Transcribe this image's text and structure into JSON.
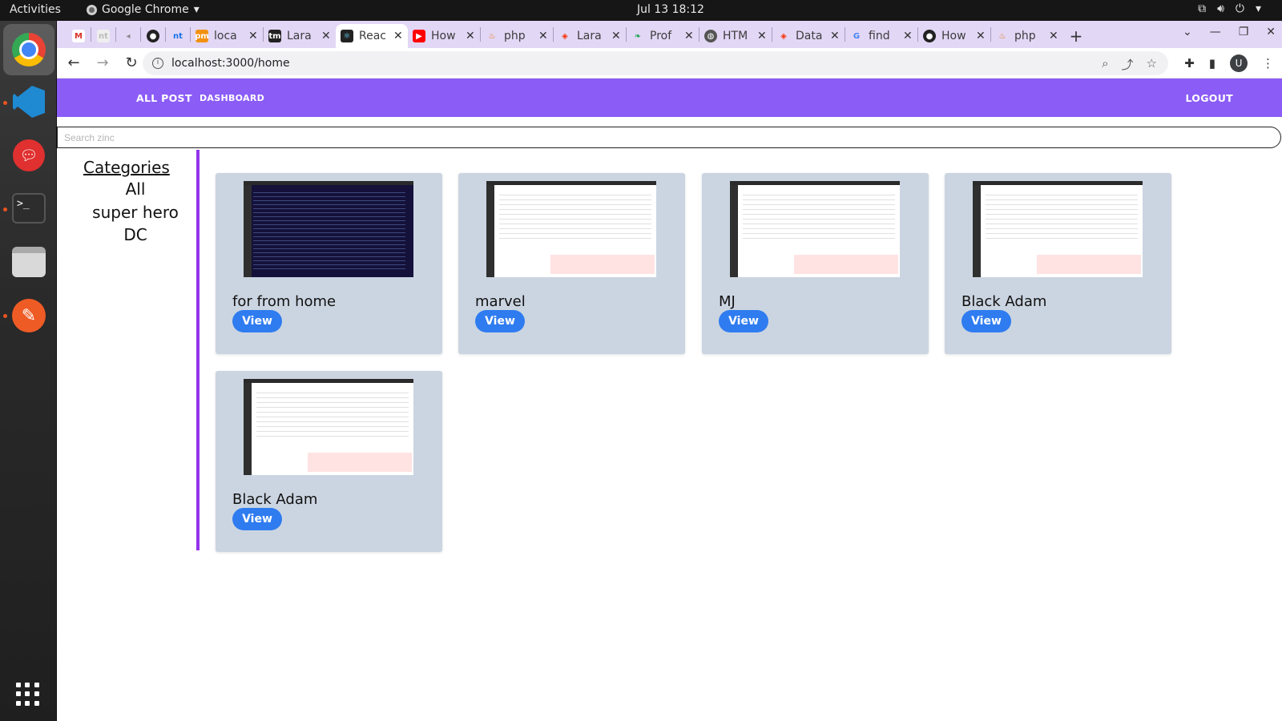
{
  "system": {
    "activities": "Activities",
    "app_name": "Google Chrome",
    "clock": "Jul 13  18:12"
  },
  "dock": {
    "apps": [
      "chrome-icon",
      "vscode-icon",
      "rocketchat-icon",
      "terminal-icon",
      "files-icon",
      "postman-icon",
      "show-apps-icon"
    ]
  },
  "browser": {
    "tabs": [
      {
        "title": "",
        "icon": "gmail-icon",
        "pinned": true
      },
      {
        "title": "",
        "icon": "nt-icon",
        "pinned": true
      },
      {
        "title": "",
        "icon": "back-icon",
        "pinned": true
      },
      {
        "title": "",
        "icon": "github-icon",
        "pinned": true
      },
      {
        "title": "",
        "icon": "nt-icon",
        "pinned": true
      },
      {
        "title": "loca",
        "icon": "pma-icon"
      },
      {
        "title": "Lara",
        "icon": "tm-icon"
      },
      {
        "title": "Reac",
        "icon": "react-icon",
        "active": true
      },
      {
        "title": "How",
        "icon": "youtube-icon"
      },
      {
        "title": "php",
        "icon": "php-icon"
      },
      {
        "title": "Lara",
        "icon": "laravel-icon"
      },
      {
        "title": "Prof",
        "icon": "leaf-icon"
      },
      {
        "title": "HTM",
        "icon": "globe-icon"
      },
      {
        "title": "Data",
        "icon": "laravel-icon"
      },
      {
        "title": "find",
        "icon": "google-icon"
      },
      {
        "title": "How",
        "icon": "dark-circle-icon"
      },
      {
        "title": "php",
        "icon": "php-icon"
      }
    ],
    "url": "localhost:3000/home",
    "profile_initial": "U"
  },
  "app": {
    "nav": {
      "all_post": "ALL POST",
      "dashboard": "DASHBOARD",
      "logout": "LOGOUT"
    },
    "search": {
      "placeholder": "Search zinc"
    },
    "categories": {
      "title": "Categories",
      "items": [
        "All",
        "super hero",
        "DC"
      ]
    },
    "posts": [
      {
        "title": "for from home",
        "view_label": "View",
        "thumb": "dark-code"
      },
      {
        "title": "marvel",
        "view_label": "View",
        "thumb": "light-screen"
      },
      {
        "title": "MJ",
        "view_label": "View",
        "thumb": "light-screen"
      },
      {
        "title": "Black Adam",
        "view_label": "View",
        "thumb": "light-screen"
      },
      {
        "title": "Black Adam",
        "view_label": "View",
        "thumb": "light-screen"
      }
    ]
  },
  "colors": {
    "navbar": "#8b5cf6",
    "card": "#cbd5e1",
    "button": "#2f7cf0",
    "sidebar_border": "#9333ea",
    "tabstrip": "#e3d7f6"
  }
}
